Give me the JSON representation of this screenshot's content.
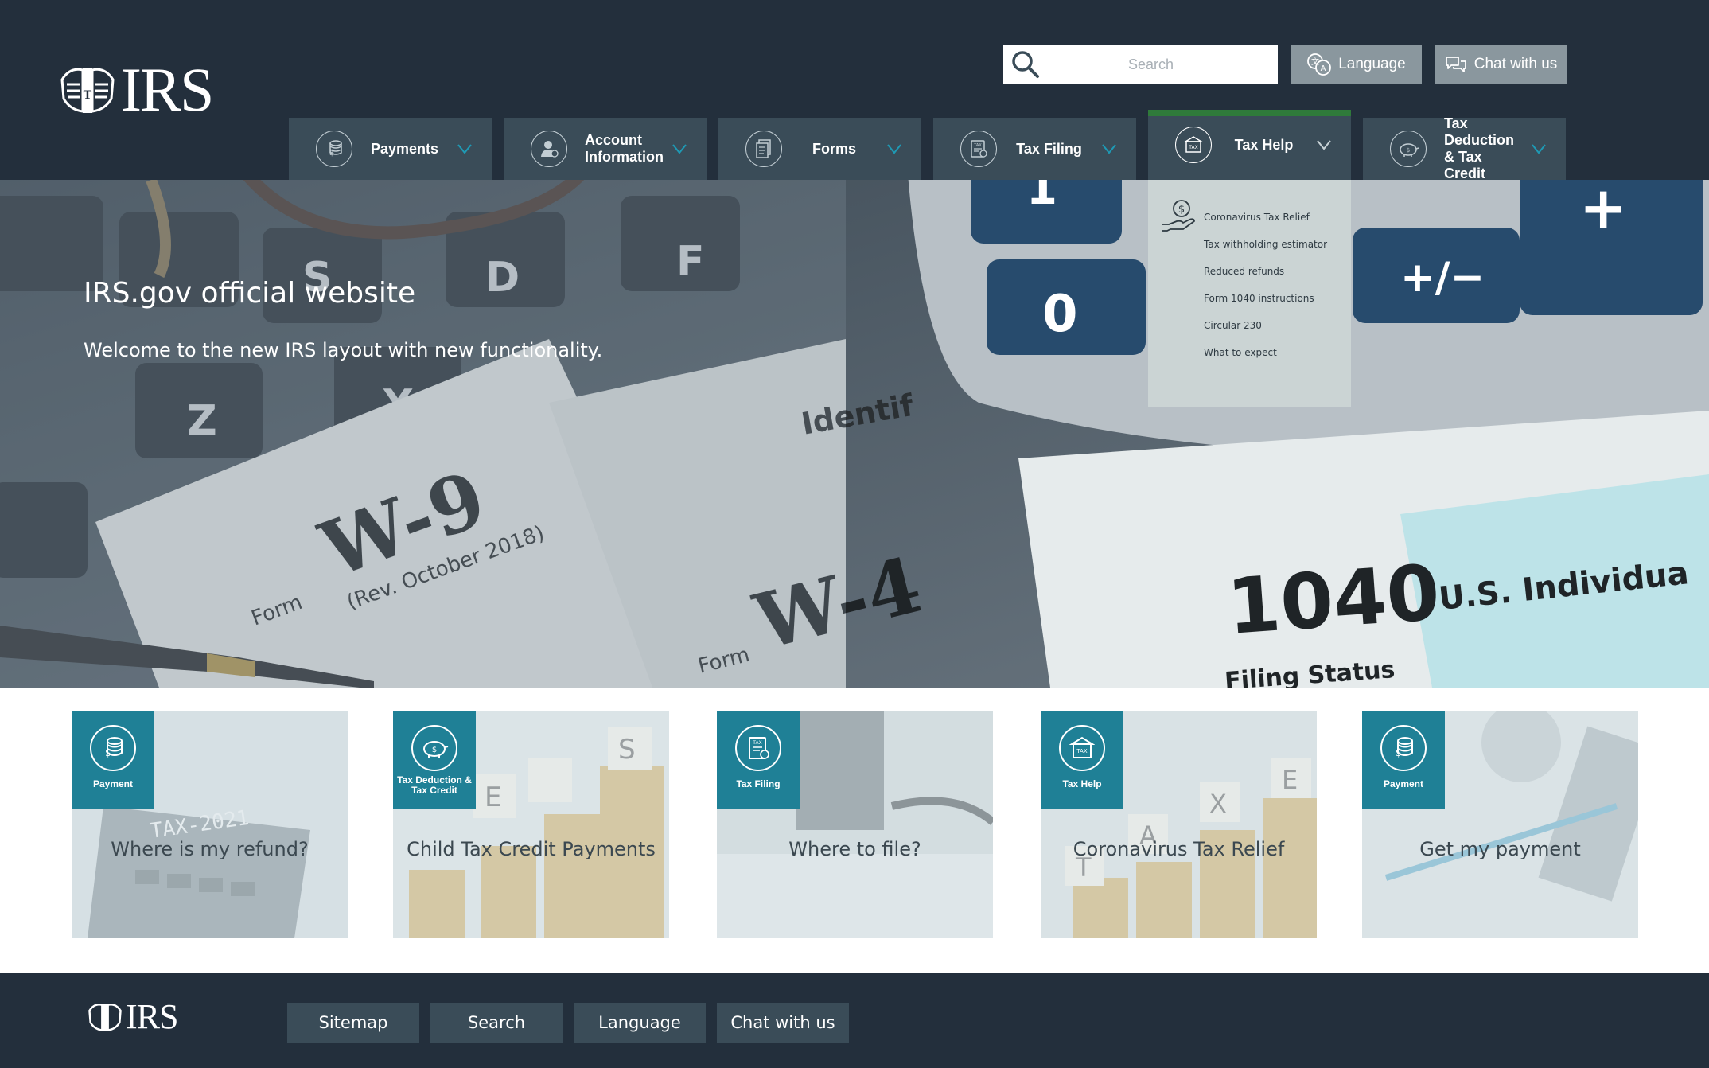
{
  "header": {
    "logo_text": "IRS",
    "search": {
      "placeholder": "Search",
      "icon": "search-icon"
    },
    "language_label": "Language",
    "chat_label": "Chat with us"
  },
  "nav": [
    {
      "label": "Payments",
      "icon": "coins-icon"
    },
    {
      "label": "Account Information",
      "icon": "user-icon"
    },
    {
      "label": "Forms",
      "icon": "document-icon"
    },
    {
      "label": "Tax Filing",
      "icon": "tax-form-icon"
    },
    {
      "label": "Tax Help",
      "icon": "building-icon",
      "active": true
    },
    {
      "label": "Tax Deduction & Tax Credit",
      "icon": "piggy-bank-icon"
    }
  ],
  "hero": {
    "title": "IRS.gov official website",
    "subtitle": "Welcome to the new IRS layout with new functionality."
  },
  "dropdown": {
    "icon": "hand-dollar-icon",
    "items": [
      "Coronavirus Tax Relief",
      "Tax withholding estimator",
      "Reduced refunds",
      "Form 1040 instructions",
      "Circular 230",
      "What to expect"
    ]
  },
  "cards": [
    {
      "badge": "Payment",
      "title": "Where is my refund?",
      "icon": "coins-icon"
    },
    {
      "badge": "Tax Deduction & Tax Credit",
      "title": "Child Tax Credit Payments",
      "icon": "piggy-bank-icon"
    },
    {
      "badge": "Tax Filing",
      "title": "Where to file?",
      "icon": "tax-form-icon"
    },
    {
      "badge": "Tax Help",
      "title": "Coronavirus Tax Relief",
      "icon": "building-icon"
    },
    {
      "badge": "Payment",
      "title": "Get my payment",
      "icon": "coins-icon"
    }
  ],
  "footer": {
    "logo_text": "IRS",
    "buttons": [
      "Sitemap",
      "Search",
      "Language",
      "Chat with us"
    ]
  },
  "colors": {
    "header_bg": "#232f3c",
    "nav_bg": "#3a4c58",
    "accent_teal": "#1f8096",
    "active_green": "#2f7a3a",
    "dropdown_bg": "#cbd4d4"
  }
}
